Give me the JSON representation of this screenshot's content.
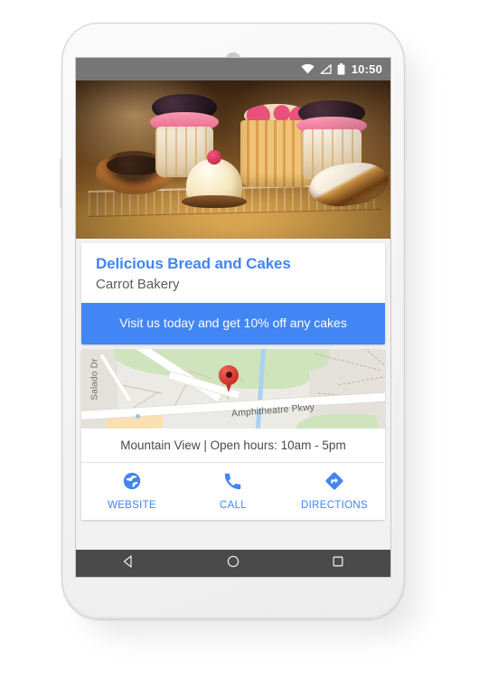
{
  "device": {
    "type": "android-phone-mockup",
    "earpiece": "speaker-grille"
  },
  "status_bar": {
    "time": "10:50",
    "icons": [
      "wifi-icon",
      "signal-icon",
      "battery-icon"
    ],
    "background_color": "#767676",
    "text_color": "#ffffff"
  },
  "ad": {
    "hero_image_alt": "bakery-display-of-cakes-and-pastries",
    "headline": "Delicious Bread and Cakes",
    "business_name": "Carrot Bakery",
    "promo_text": "Visit us today and get 10% off any cakes",
    "accent_color": "#4285f4",
    "headline_color": "#4285f4",
    "business_color": "#5c5c5c"
  },
  "map": {
    "labels": {
      "street_vertical": "Salado Dr",
      "street_horizontal": "Amphitheatre Pkwy"
    },
    "marker": "map-pin-marker",
    "marker_color": "#cb2d24"
  },
  "details": {
    "address_line": "Mountain View | Open hours: 10am - 5pm"
  },
  "actions": [
    {
      "label": "WEBSITE",
      "icon": "globe-icon"
    },
    {
      "label": "CALL",
      "icon": "phone-icon"
    },
    {
      "label": "DIRECTIONS",
      "icon": "directions-icon"
    }
  ],
  "nav_bar": {
    "buttons": [
      {
        "name": "back",
        "icon": "triangle-back-icon"
      },
      {
        "name": "home",
        "icon": "circle-home-icon"
      },
      {
        "name": "recents",
        "icon": "square-recents-icon"
      }
    ],
    "background_color": "#4a4a4a"
  }
}
